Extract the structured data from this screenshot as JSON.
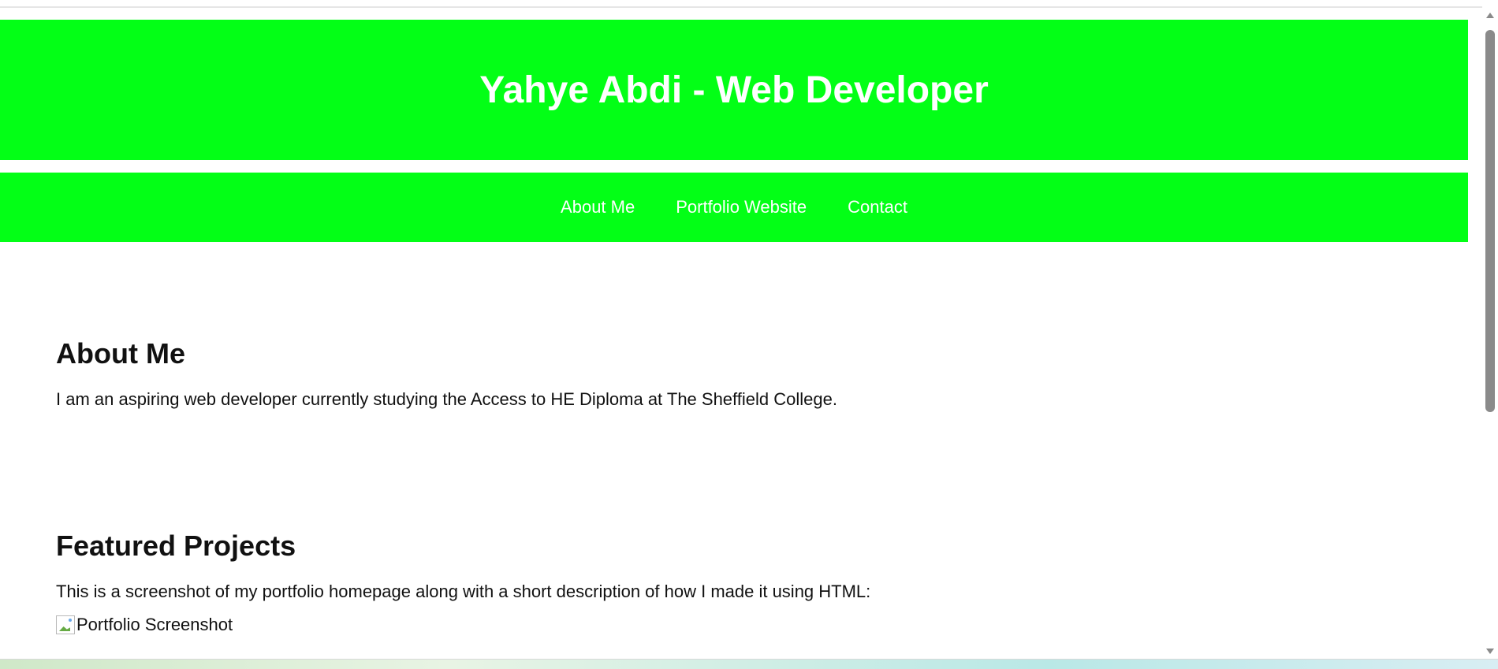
{
  "header": {
    "title": "Yahye Abdi - Web Developer"
  },
  "nav": {
    "items": [
      {
        "label": "About Me"
      },
      {
        "label": "Portfolio Website"
      },
      {
        "label": "Contact"
      }
    ]
  },
  "about": {
    "heading": "About Me",
    "text": "I am an aspiring web developer currently studying the Access to HE Diploma at The Sheffield College."
  },
  "projects": {
    "heading": "Featured Projects",
    "text": "This is a screenshot of my portfolio homepage along with a short description of how I made it using HTML:",
    "image_alt": "Portfolio Screenshot"
  },
  "colors": {
    "accent": "#03ff16",
    "header_text": "#ffffff"
  }
}
